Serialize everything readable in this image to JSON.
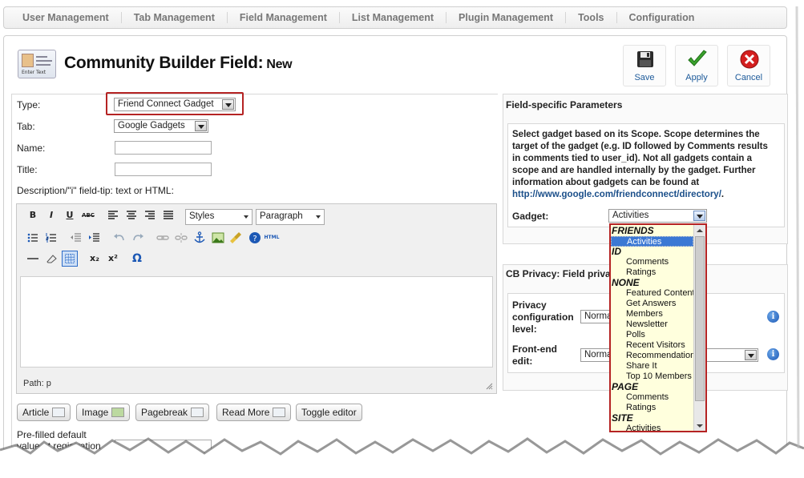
{
  "nav": {
    "items": [
      "User Management",
      "Tab Management",
      "Field Management",
      "List Management",
      "Plugin Management",
      "Tools",
      "Configuration"
    ]
  },
  "header": {
    "title": "Community Builder Field:",
    "subtitle": "New",
    "icon_text": "Enter Text"
  },
  "toolbar": {
    "save_label": "Save",
    "apply_label": "Apply",
    "cancel_label": "Cancel"
  },
  "form": {
    "type_label": "Type:",
    "type_value": "Friend Connect Gadget",
    "tab_label": "Tab:",
    "tab_value": "Google Gadgets",
    "name_label": "Name:",
    "name_value": "",
    "title_label": "Title:",
    "title_value": "",
    "description_label": "Description/\"i\" field-tip: text or HTML:",
    "prefilled_line1": "Pre-filled default",
    "prefilled_line2": "value at registration"
  },
  "editor": {
    "styles_value": "Styles",
    "format_value": "Paragraph",
    "path_text": "Path: p",
    "buttons": [
      "Article",
      "Image",
      "Pagebreak",
      "Read More",
      "Toggle editor"
    ],
    "icons_row1": [
      "bold-icon",
      "italic-icon",
      "underline-icon",
      "strikethrough-icon",
      "align-left-icon",
      "align-center-icon",
      "align-right-icon",
      "align-justify-icon"
    ],
    "icons_row2": [
      "bullet-list-icon",
      "numbered-list-icon",
      "outdent-icon",
      "indent-icon",
      "undo-icon",
      "redo-icon",
      "link-icon",
      "unlink-icon",
      "anchor-icon",
      "image-icon",
      "cleanup-icon",
      "help-icon",
      "html-icon"
    ],
    "icons_row3": [
      "horizontal-rule-icon",
      "eraser-icon",
      "visual-aid-icon",
      "subscript-icon",
      "superscript-icon",
      "special-char-icon"
    ],
    "glyphs": {
      "bold": "B",
      "italic": "I",
      "underline": "U",
      "strike": "ABC",
      "html": "HTML",
      "sub": "x₂",
      "sup": "x²",
      "omega": "Ω"
    }
  },
  "params": {
    "heading": "Field-specific Parameters",
    "description": "Select gadget based on its Scope. Scope determines the target of the gadget (e.g. ID followed by Comments results in comments tied to user_id). Not all gadgets contain a scope and are handled internally by the gadget. Further information about gadgets can be found at",
    "link_text": "http://www.google.com/friendconnect/directory/",
    "link_suffix": ".",
    "gadget_label": "Gadget:",
    "gadget_value": "Activities"
  },
  "privacy": {
    "heading": "CB Privacy: Field privac",
    "config_label": "Privacy configuration level:",
    "config_value": "Norma",
    "frontend_label": "Front-end edit:",
    "frontend_value": "Norma"
  },
  "gadget_dropdown": {
    "items": [
      {
        "text": "FRIENDS",
        "kind": "grp"
      },
      {
        "text": "Activities",
        "kind": "sel"
      },
      {
        "text": "ID",
        "kind": "grp"
      },
      {
        "text": "Comments",
        "kind": "opt"
      },
      {
        "text": "Ratings",
        "kind": "opt"
      },
      {
        "text": "NONE",
        "kind": "grp"
      },
      {
        "text": "Featured Content",
        "kind": "opt"
      },
      {
        "text": "Get Answers",
        "kind": "opt"
      },
      {
        "text": "Members",
        "kind": "opt"
      },
      {
        "text": "Newsletter",
        "kind": "opt"
      },
      {
        "text": "Polls",
        "kind": "opt"
      },
      {
        "text": "Recent Visitors",
        "kind": "opt"
      },
      {
        "text": "Recommendations",
        "kind": "opt"
      },
      {
        "text": "Share It",
        "kind": "opt"
      },
      {
        "text": "Top 10 Members",
        "kind": "opt"
      },
      {
        "text": "PAGE",
        "kind": "grp"
      },
      {
        "text": "Comments",
        "kind": "opt"
      },
      {
        "text": "Ratings",
        "kind": "opt"
      },
      {
        "text": "SITE",
        "kind": "grp"
      },
      {
        "text": "Activities",
        "kind": "opt"
      }
    ]
  },
  "colors": {
    "highlight_border": "#b52323",
    "link": "#1b4f8a",
    "toolbar_label": "#1d5a9a",
    "selected_option": "#3b78d4",
    "dropdown_bg": "#ffffdd"
  }
}
